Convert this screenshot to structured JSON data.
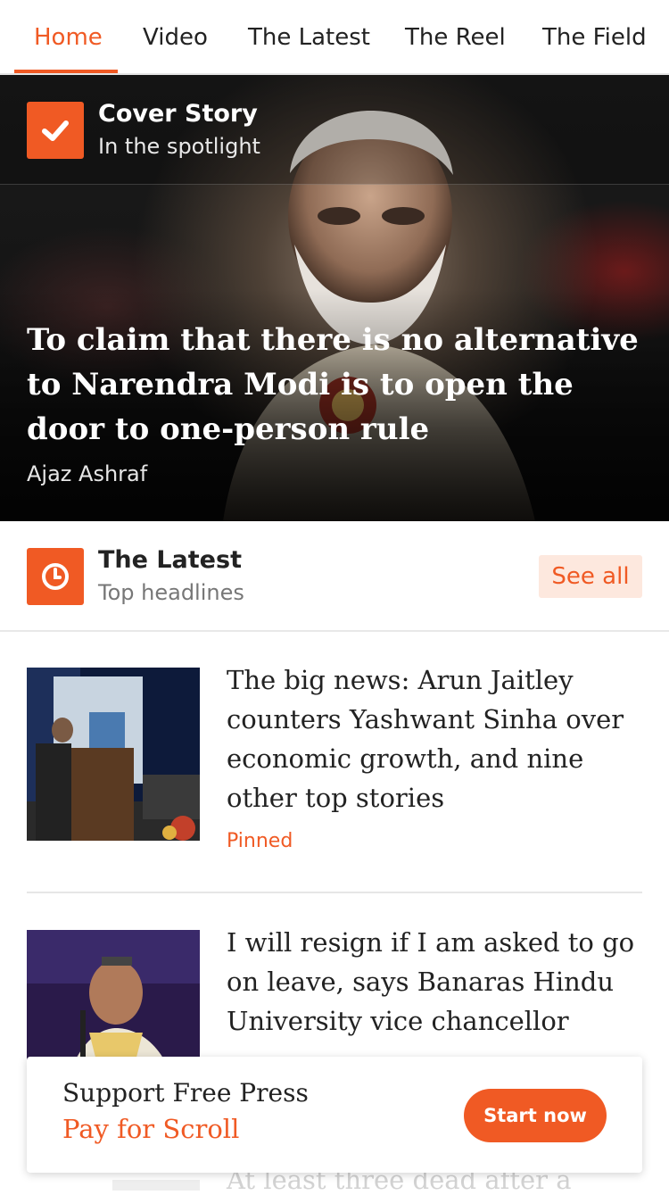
{
  "nav": {
    "tabs": [
      {
        "label": "Home",
        "active": true
      },
      {
        "label": "Video"
      },
      {
        "label": "The Latest"
      },
      {
        "label": "The Reel"
      },
      {
        "label": "The Field"
      }
    ]
  },
  "cover": {
    "section_title": "Cover Story",
    "section_subtitle": "In the spotlight",
    "icon": "checkmark-icon",
    "headline": "To claim that there is no alternative to Narendra Modi is to open the door to one-person rule",
    "author": "Ajaz Ashraf"
  },
  "latest": {
    "section_title": "The Latest",
    "section_subtitle": "Top headlines",
    "icon": "clock-icon",
    "see_all_label": "See all",
    "articles": [
      {
        "title": "The big news: Arun Jaitley counters Yashwant Sinha over economic growth, and nine other top stories",
        "tag": "Pinned"
      },
      {
        "title": "I will resign if I am asked to go on leave, says Banaras Hindu University vice chancellor"
      }
    ],
    "partial_next_title": "At least three dead after a"
  },
  "support": {
    "line1": "Support Free Press",
    "line2": "Pay for Scroll",
    "button_label": "Start now"
  },
  "colors": {
    "accent": "#f05a24",
    "see_all_bg": "#fde8de"
  }
}
